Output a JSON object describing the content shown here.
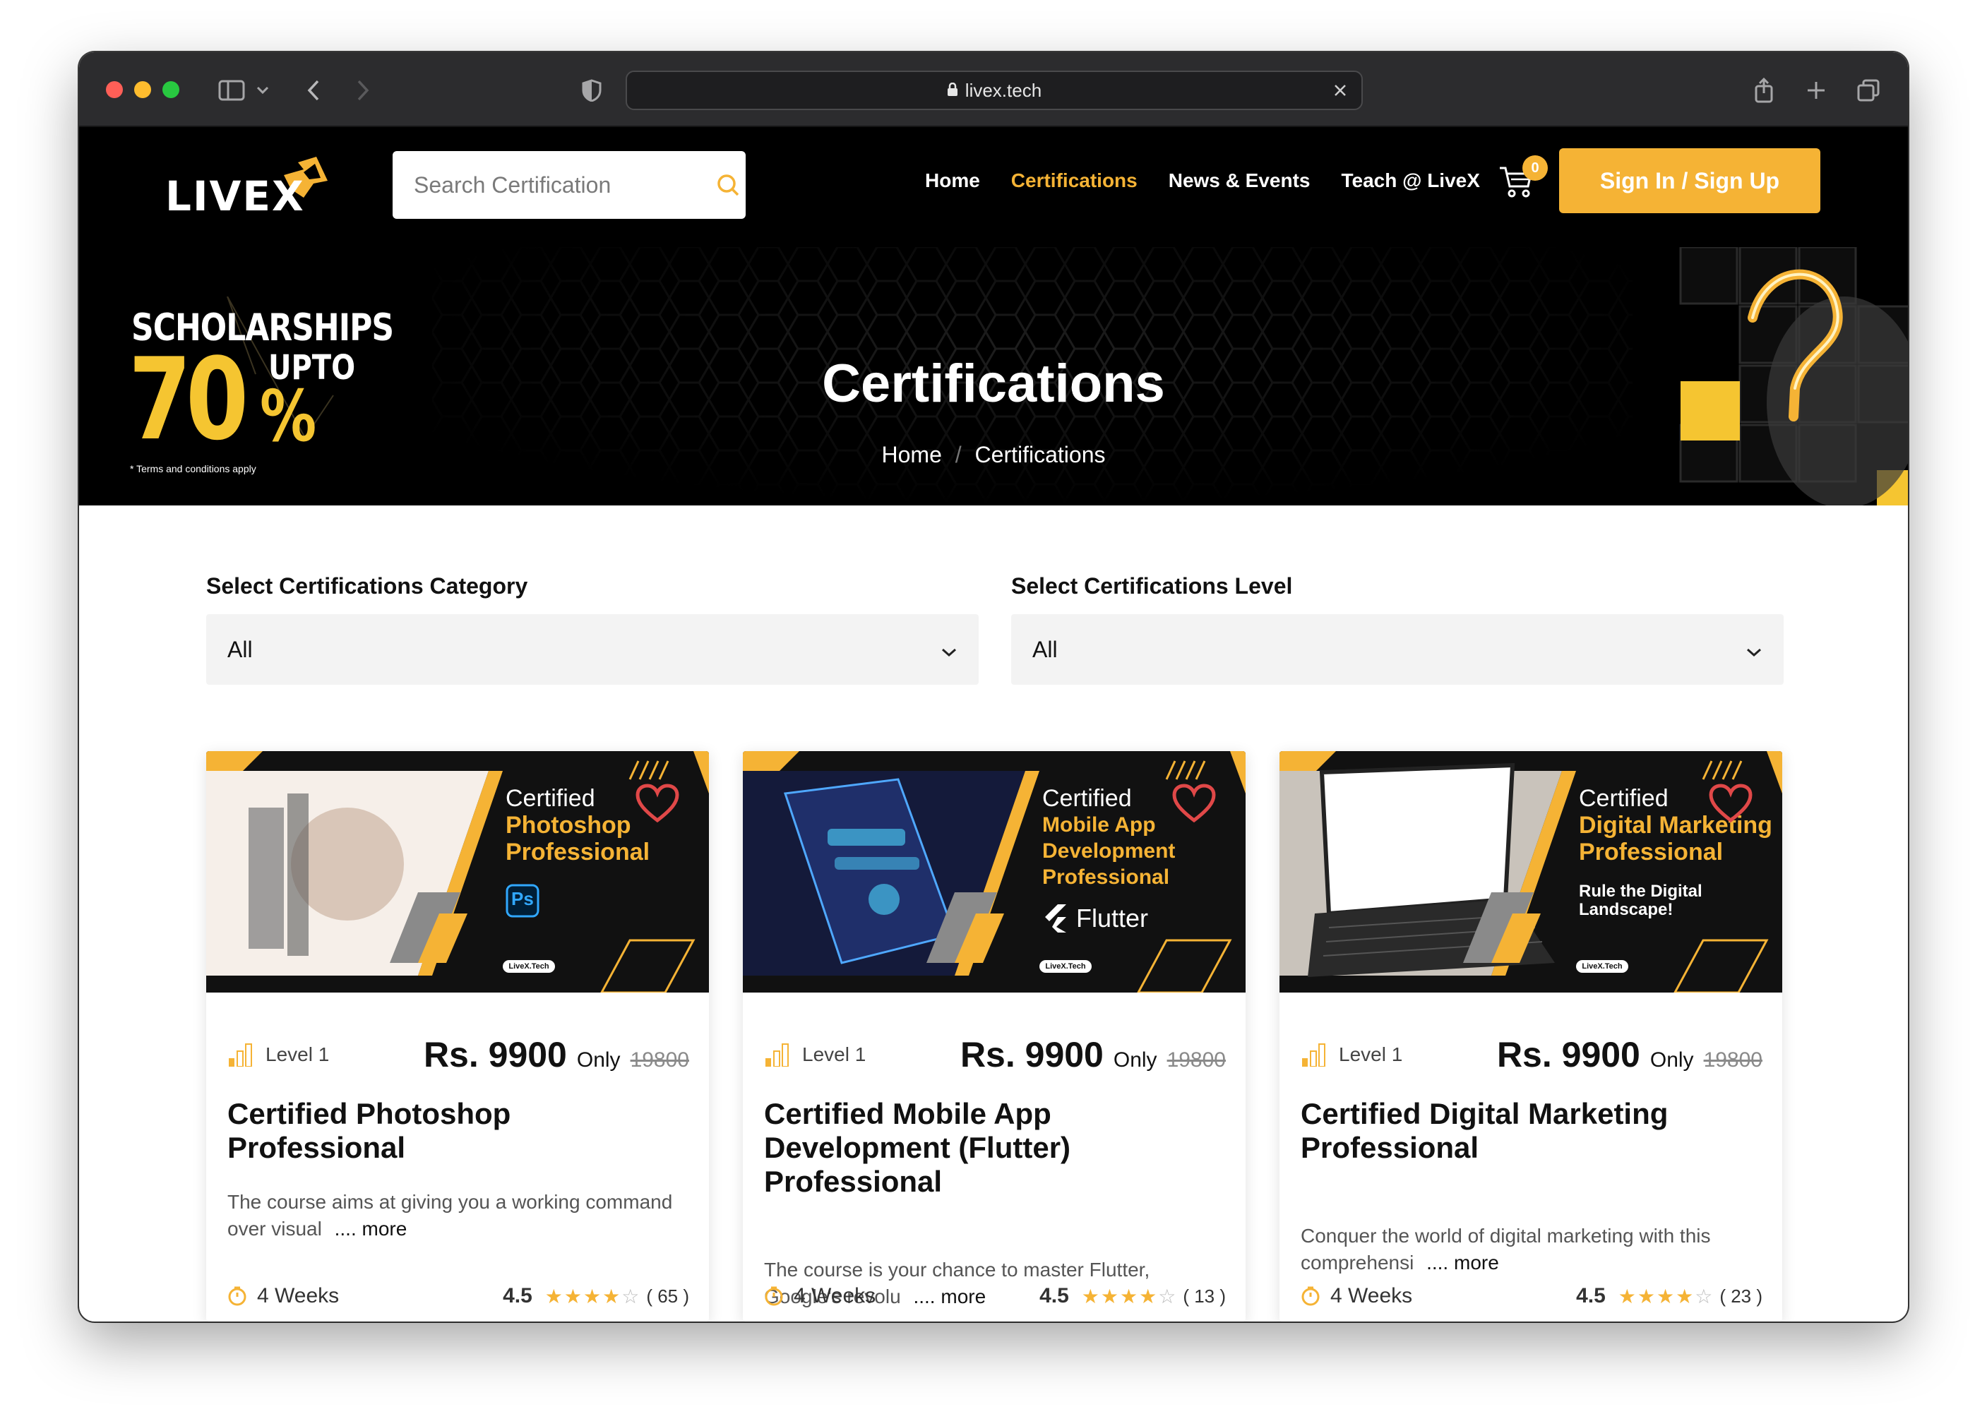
{
  "browser": {
    "url": "livex.tech"
  },
  "header": {
    "logo_text": "LIVEX",
    "search": {
      "placeholder": "Search Certification"
    },
    "nav": [
      {
        "label": "Home",
        "active": false
      },
      {
        "label": "Certifications",
        "active": true
      },
      {
        "label": "News & Events",
        "active": false
      },
      {
        "label": "Teach @ LiveX",
        "active": false
      }
    ],
    "cart_count": "0",
    "signin_label": "Sign In / Sign Up"
  },
  "hero": {
    "title": "Certifications",
    "breadcrumb": [
      "Home",
      "Certifications"
    ],
    "promo": {
      "heading": "SCHOLARSHIPS",
      "upto": "UPTO",
      "big": "70",
      "pct": "%",
      "terms": "* Terms and conditions apply"
    }
  },
  "filters": {
    "category_label": "Select Certifications Category",
    "category_value": "All",
    "level_label": "Select Certifications Level",
    "level_value": "All"
  },
  "cards": [
    {
      "banner_certified": "Certified",
      "banner_name": "Photoshop Professional",
      "banner_brand": "Ps",
      "banner_pill": "LiveX.Tech",
      "level": "Level 1",
      "price": "Rs. 9900",
      "only": "Only",
      "old_price": "19800",
      "title": "Certified Photoshop Professional",
      "description": "The course aims at giving you a working command over visual",
      "more": ".... more",
      "duration": "4 Weeks",
      "rating": "4.5",
      "reviews": "( 65 )"
    },
    {
      "banner_certified": "Certified",
      "banner_name": "Mobile App Development Professional",
      "banner_brand": "Flutter",
      "banner_pill": "LiveX.Tech",
      "level": "Level 1",
      "price": "Rs. 9900",
      "only": "Only",
      "old_price": "19800",
      "title": "Certified Mobile App Development (Flutter) Professional",
      "description": "The course is your chance to master Flutter, Google's revolu",
      "more": ".... more",
      "duration": "4 Weeks",
      "rating": "4.5",
      "reviews": "( 13 )"
    },
    {
      "banner_certified": "Certified",
      "banner_name": "Digital Marketing Professional",
      "banner_tagline": "Rule the Digital Landscape!",
      "banner_pill": "LiveX.Tech",
      "level": "Level 1",
      "price": "Rs. 9900",
      "only": "Only",
      "old_price": "19800",
      "title": "Certified Digital Marketing Professional",
      "description": "Conquer the world of digital marketing with this comprehensi",
      "more": ".... more",
      "duration": "4 Weeks",
      "rating": "4.5",
      "reviews": "( 23 )"
    }
  ],
  "colors": {
    "accent": "#f5b335",
    "header_bg": "#000000",
    "select_bg": "#f3f3f3"
  }
}
